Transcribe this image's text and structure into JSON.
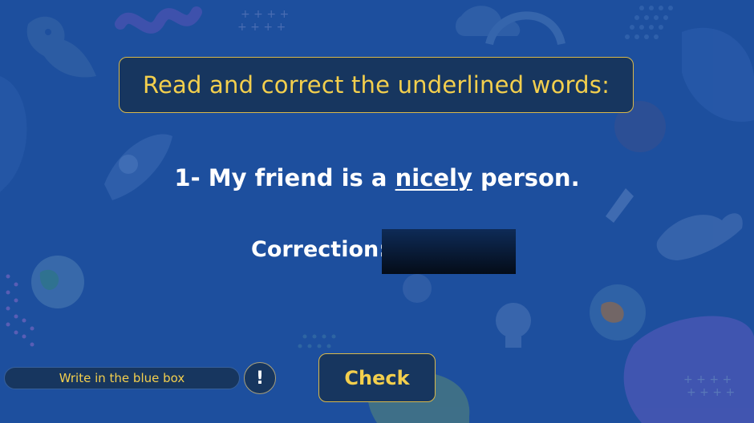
{
  "colors": {
    "background": "#1d4f9e",
    "panel": "#17365f",
    "accent_yellow": "#f3cf4d",
    "border_gold": "#d9b84a",
    "text_white": "#ffffff"
  },
  "header": {
    "title": "Read and correct the underlined words:"
  },
  "question": {
    "number": "1-",
    "prefix": "My friend is a",
    "underlined_word": "nicely",
    "suffix": "person."
  },
  "correction": {
    "label": "Correction:",
    "value": ""
  },
  "hint": {
    "text": "Write in the blue box",
    "icon": "exclamation-icon",
    "icon_glyph": "!"
  },
  "check_button": {
    "label": "Check"
  }
}
